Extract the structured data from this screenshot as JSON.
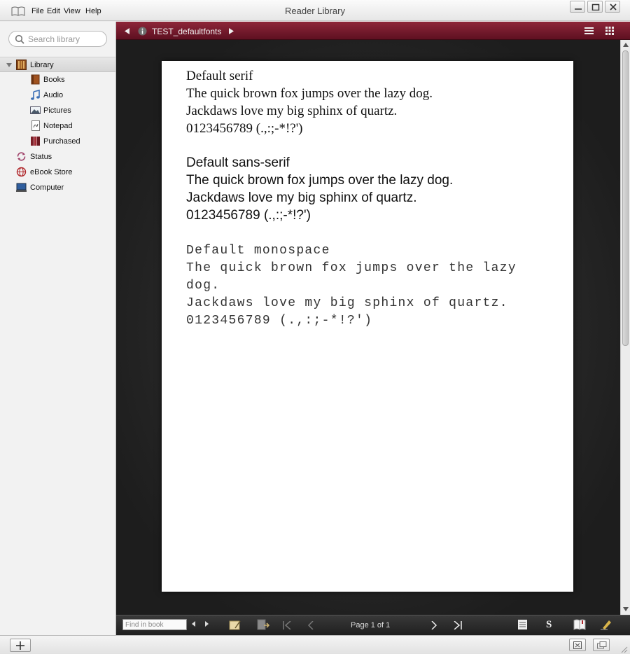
{
  "window": {
    "title": "Reader Library"
  },
  "menu": {
    "file": "File",
    "edit": "Edit",
    "view": "View",
    "help": "Help"
  },
  "sidebar": {
    "search_placeholder": "Search library",
    "items": [
      {
        "label": "Library",
        "icon": "library-shelf-icon",
        "selected": true
      },
      {
        "label": "Books",
        "icon": "books-icon"
      },
      {
        "label": "Audio",
        "icon": "music-note-icon"
      },
      {
        "label": "Pictures",
        "icon": "picture-icon"
      },
      {
        "label": "Notepad",
        "icon": "notepad-icon"
      },
      {
        "label": "Purchased",
        "icon": "purchased-books-icon"
      },
      {
        "label": "Status",
        "icon": "sync-icon"
      },
      {
        "label": "eBook Store",
        "icon": "globe-icon"
      },
      {
        "label": "Computer",
        "icon": "computer-icon"
      }
    ]
  },
  "reader": {
    "document_title": "TEST_defaultfonts",
    "page": {
      "serif": {
        "heading": "Default serif",
        "line1": "The quick brown fox jumps over the lazy dog.",
        "line2": "Jackdaws love my big sphinx of quartz.",
        "line3": "0123456789 (.,:;-*!?')"
      },
      "sans": {
        "heading": "Default sans-serif",
        "line1": "The quick brown fox jumps over the lazy dog.",
        "line2": "Jackdaws love my big sphinx of quartz.",
        "line3": "0123456789 (.,:;-*!?')"
      },
      "mono": {
        "heading": "Default monospace",
        "line1a": "The quick brown fox jumps over the lazy",
        "line1b": "dog.",
        "line2": "Jackdaws love my big sphinx of quartz.",
        "line3": "0123456789 (.,:;-*!?')"
      }
    },
    "toolbar": {
      "find_placeholder": "Find in book",
      "page_indicator": "Page 1 of 1",
      "sync_label": "S"
    }
  },
  "colors": {
    "accent": "#7a1a2e",
    "reader_background": "#2b2b2b"
  }
}
